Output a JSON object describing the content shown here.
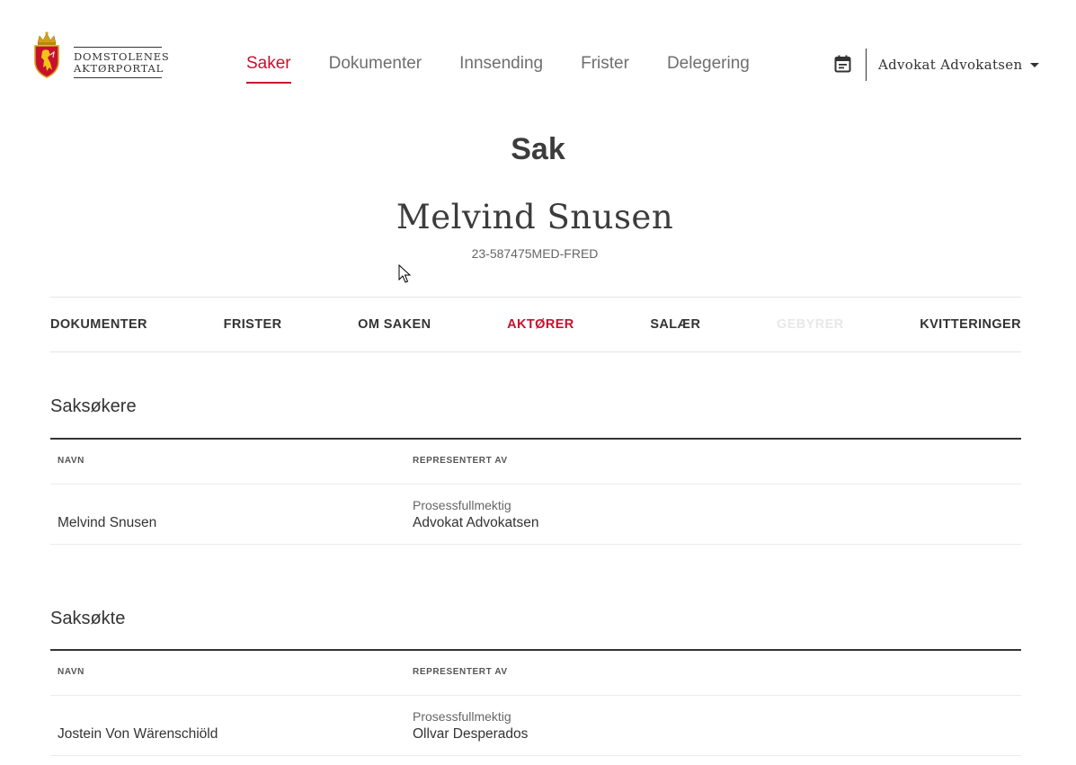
{
  "logo": {
    "line1": "DOMSTOLENES",
    "line2": "AKTØRPORTAL",
    "icon": "coat-of-arms-icon"
  },
  "nav": {
    "items": [
      {
        "label": "Saker",
        "active": true
      },
      {
        "label": "Dokumenter",
        "active": false
      },
      {
        "label": "Innsending",
        "active": false
      },
      {
        "label": "Frister",
        "active": false
      },
      {
        "label": "Delegering",
        "active": false
      }
    ]
  },
  "header": {
    "calendar_icon": "calendar-icon",
    "user_name": "Advokat Advokatsen",
    "user_menu_icon": "caret-down-icon"
  },
  "page": {
    "title": "Sak",
    "case_name": "Melvind Snusen",
    "case_number": "23-587475MED-FRED"
  },
  "tabs": [
    {
      "label": "DOKUMENTER",
      "state": "normal"
    },
    {
      "label": "FRISTER",
      "state": "normal"
    },
    {
      "label": "OM SAKEN",
      "state": "normal"
    },
    {
      "label": "AKTØRER",
      "state": "active"
    },
    {
      "label": "SALÆR",
      "state": "normal"
    },
    {
      "label": "GEBYRER",
      "state": "disabled"
    },
    {
      "label": "KVITTERINGER",
      "state": "normal"
    }
  ],
  "plaintiffs": {
    "title": "Saksøkere",
    "col_name": "NAVN",
    "col_rep": "REPRESENTERT AV",
    "rows": [
      {
        "name": "Melvind Snusen",
        "role": "Prosessfullmektig",
        "rep": "Advokat Advokatsen"
      }
    ]
  },
  "defendants": {
    "title": "Saksøkte",
    "col_name": "NAVN",
    "col_rep": "REPRESENTERT AV",
    "rows": [
      {
        "name": "Jostein Von Wärenschiöld",
        "role": "Prosessfullmektig",
        "rep": "Ollvar Desperados"
      }
    ]
  },
  "colors": {
    "accent": "#c8102e",
    "text": "#333333",
    "muted": "#6f6f6f",
    "disabled": "#e8e8e8"
  }
}
